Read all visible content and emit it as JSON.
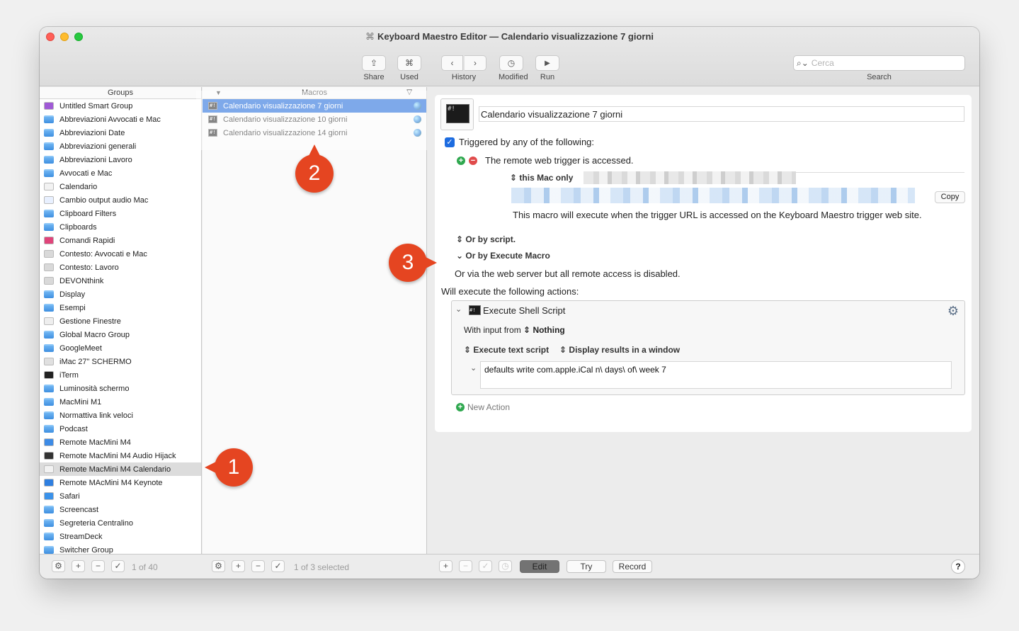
{
  "window": {
    "title_icon": "⌘",
    "title": "Keyboard Maestro Editor — Calendario visualizzazione 7 giorni"
  },
  "toolbar": {
    "share_label": "Share",
    "used_label": "Used",
    "history_label": "History",
    "modified_label": "Modified",
    "run_label": "Run",
    "search_placeholder": "Cerca",
    "search_label": "Search"
  },
  "groups": {
    "header": "Groups",
    "items": [
      {
        "label": "Untitled Smart Group",
        "icon": "smart-group-icon",
        "color": "#a05ad6"
      },
      {
        "label": "Abbreviazioni Avvocati e Mac",
        "icon": "folder-icon"
      },
      {
        "label": "Abbreviazioni Date",
        "icon": "folder-icon"
      },
      {
        "label": "Abbreviazioni generali",
        "icon": "folder-icon"
      },
      {
        "label": "Abbreviazioni Lavoro",
        "icon": "folder-icon"
      },
      {
        "label": "Avvocati e Mac",
        "icon": "folder-icon"
      },
      {
        "label": "Calendario",
        "icon": "calendar-icon"
      },
      {
        "label": "Cambio output audio Mac",
        "icon": "speaker-icon"
      },
      {
        "label": "Clipboard Filters",
        "icon": "folder-icon"
      },
      {
        "label": "Clipboards",
        "icon": "folder-icon"
      },
      {
        "label": "Comandi Rapidi",
        "icon": "shortcuts-icon"
      },
      {
        "label": "Contesto: Avvocati e Mac",
        "icon": "app-icon"
      },
      {
        "label": "Contesto: Lavoro",
        "icon": "app-icon"
      },
      {
        "label": "DEVONthink",
        "icon": "app-icon"
      },
      {
        "label": "Display",
        "icon": "folder-icon"
      },
      {
        "label": "Esempi",
        "icon": "folder-icon"
      },
      {
        "label": "Gestione Finestre",
        "icon": "window-icon"
      },
      {
        "label": "Global Macro Group",
        "icon": "folder-icon"
      },
      {
        "label": "GoogleMeet",
        "icon": "folder-icon"
      },
      {
        "label": "iMac 27\" SCHERMO",
        "icon": "display-icon"
      },
      {
        "label": "iTerm",
        "icon": "terminal-icon"
      },
      {
        "label": "Luminosità schermo",
        "icon": "folder-icon"
      },
      {
        "label": "MacMini M1",
        "icon": "folder-icon"
      },
      {
        "label": "Normattiva link veloci",
        "icon": "folder-icon"
      },
      {
        "label": "Podcast",
        "icon": "folder-icon"
      },
      {
        "label": "Remote MacMini M4",
        "icon": "globe-icon"
      },
      {
        "label": "Remote MacMini M4 Audio Hijack",
        "icon": "audio-hijack-icon"
      },
      {
        "label": "Remote MacMini M4 Calendario",
        "icon": "calendar-icon"
      },
      {
        "label": "Remote MAcMini M4 Keynote",
        "icon": "keynote-icon"
      },
      {
        "label": "Safari",
        "icon": "safari-icon"
      },
      {
        "label": "Screencast",
        "icon": "folder-icon"
      },
      {
        "label": "Segreteria Centralino",
        "icon": "folder-icon"
      },
      {
        "label": "StreamDeck",
        "icon": "folder-icon"
      },
      {
        "label": "Switcher Group",
        "icon": "folder-icon"
      }
    ],
    "footer_count": "1 of 40"
  },
  "macros": {
    "header": "Macros",
    "items": [
      {
        "label": "Calendario visualizzazione 7 giorni",
        "selected": true
      },
      {
        "label": "Calendario visualizzazione 10 giorni",
        "selected": false
      },
      {
        "label": "Calendario visualizzazione 14 giorni",
        "selected": false
      }
    ],
    "footer_count": "1 of 3 selected"
  },
  "detail": {
    "macro_name": "Calendario visualizzazione 7 giorni",
    "trigger_header": "Triggered by any of the following:",
    "trigger_text": "The remote web trigger is accessed.",
    "scope_popup": "this Mac only",
    "copy_button": "Copy",
    "trigger_note": "This macro will execute when the trigger URL is accessed on the Keyboard Maestro trigger web site.",
    "or_by_script": "Or by script.",
    "or_by_execute": "Or by Execute Macro",
    "web_server_note": "Or via the web server but all remote access is disabled.",
    "will_execute": "Will execute the following actions:",
    "action": {
      "title": "Execute Shell Script",
      "input_prefix": "With input from",
      "input_value": "Nothing",
      "mode": "Execute text script",
      "output": "Display results in a window",
      "script": "defaults write com.apple.iCal n\\ days\\ of\\ week 7"
    },
    "new_action": "New Action"
  },
  "footer_buttons": {
    "edit": "Edit",
    "try": "Try",
    "record": "Record",
    "help": "?"
  },
  "callouts": [
    "1",
    "2",
    "3"
  ],
  "colors": {
    "selection": "#1463d9",
    "callout": "#e54521"
  }
}
